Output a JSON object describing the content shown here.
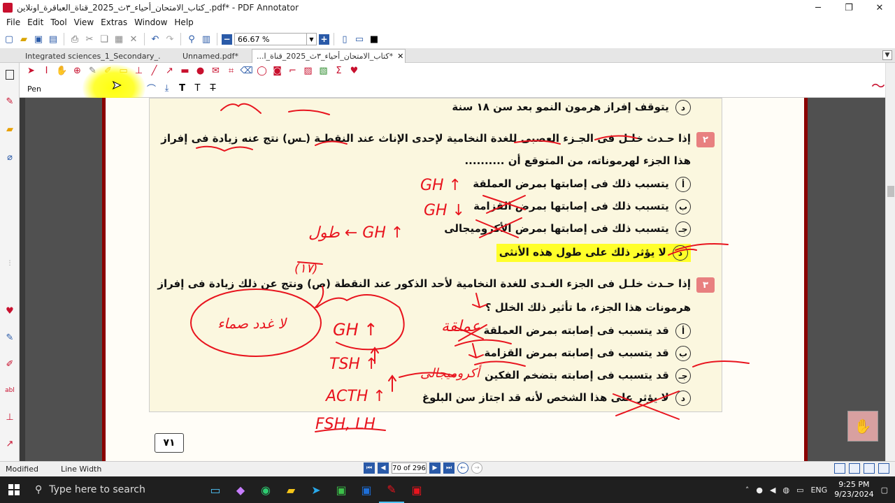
{
  "window": {
    "title": "كتاب_الامتحان_أحياء_٣ث_2025_قناة_العباقرة_اونلاين_.pdf* - PDF Annotator",
    "minimize": "─",
    "maximize": "❐",
    "close": "✕"
  },
  "menu": [
    "File",
    "Edit",
    "Tool",
    "View",
    "Extras",
    "Window",
    "Help"
  ],
  "toolbar": {
    "zoom_value": "66.67 %",
    "zoom_minus": "−",
    "zoom_plus": "+"
  },
  "tabs": [
    {
      "label": "Integrated sciences_1_Secondary_...*"
    },
    {
      "label": "Unnamed.pdf*"
    },
    {
      "label": "...كتاب_الامتحان_أحياء_٣ث_2025_قناة_ا*",
      "close": "✕"
    }
  ],
  "annotation_toolbar": {
    "tool_label": "Pen"
  },
  "document": {
    "q1_option_d": "يتوقف إفراز هرمون النمو بعد سن ١٨ سنة",
    "q2": {
      "number": "٢",
      "stem_line1": "إذا حـدث خلـل فى الجـزء العصبى للغدة النخامية لإحدى الإناث عند النقطـة (ـس) نتج عنه زيادة فى إفراز",
      "stem_line2": "هذا الجزء لهرموناته، من المتوقع أن ..........",
      "options": [
        {
          "letter": "أ",
          "text": "يتسبب ذلك فى إصابتها بمرض العملقة"
        },
        {
          "letter": "ب",
          "text": "يتسبب ذلك فى إصابتها بمرض القزامة"
        },
        {
          "letter": "جـ",
          "text": "يتسبب ذلك فى إصابتها بمرض الأكروميجالى"
        },
        {
          "letter": "د",
          "text": "لا يؤثر ذلك على طول هذه الأنثى"
        }
      ]
    },
    "q3": {
      "number": "٣",
      "stem_line1": "إذا حـدث خلـل فى الجزء الغـدى للغدة النخامية لأحد الذكور عند النقطة (ص) ونتج عن ذلك زيادة فى إفراز",
      "stem_line2": "هرمونات هذا الجزء، ما تأثير ذلك الخلل ؟",
      "options": [
        {
          "letter": "أ",
          "text": "قد يتسبب فى إصابته بمرض العملقة"
        },
        {
          "letter": "ب",
          "text": "قد يتسبب فى إصابته بمرض القزامة"
        },
        {
          "letter": "جـ",
          "text": "قد يتسبب فى إصابته بتضخم الفكين"
        },
        {
          "letter": "د",
          "text": "لا يؤثر على هذا الشخص لأنه قد اجتاز سن البلوغ"
        }
      ]
    },
    "page_number": "٧١"
  },
  "ink_text": {
    "gh_up": "GH ↑",
    "gh_down": "GH ↓",
    "gh_arrow": "طول ← GH ↑",
    "gh_uparrow": "GH ↑",
    "tsh": "TSH ↑",
    "acth": "ACTH ↑",
    "fsh_lh": "FSH, LH",
    "note_bubble": "لا غدد صماء",
    "note_ar2": "عملقة",
    "note_ar3": "أكروميجالى",
    "note_time": "(١٧)"
  },
  "statusbar": {
    "modified": "Modified",
    "line_width": "Line Width",
    "page_display": "70 of 296"
  },
  "taskbar": {
    "search_placeholder": "Type here to search",
    "lang": "ENG",
    "time": "9:25 PM",
    "date": "9/23/2024"
  },
  "colors": {
    "ink_red": "#e8141e",
    "highlight": "#ffff2a",
    "accent_blue": "#2a5aa8"
  }
}
